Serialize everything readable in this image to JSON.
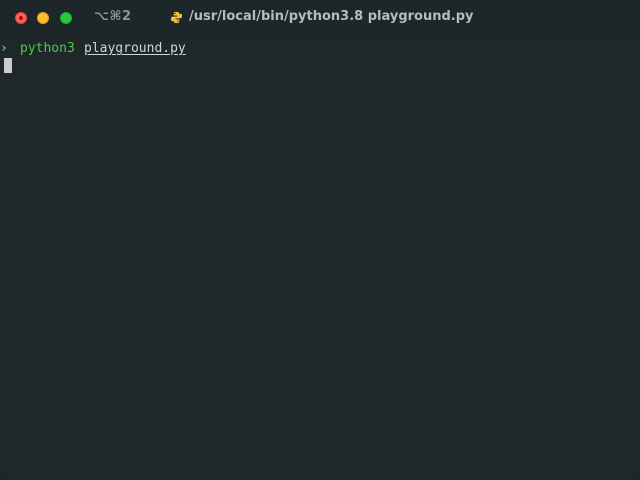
{
  "window": {
    "shortcut": "⌥⌘2",
    "title": "/usr/local/bin/python3.8 playground.py"
  },
  "terminal": {
    "prompt_symbol": "›",
    "command": "python3",
    "argument": "playground.py"
  },
  "colors": {
    "background": "#1f2729",
    "command": "#4cc94a",
    "prompt": "#3fc4e8",
    "close": "#ff5f57",
    "minimize": "#febc2e",
    "zoom": "#28c840"
  },
  "icons": {
    "title_icon": "python-icon"
  }
}
